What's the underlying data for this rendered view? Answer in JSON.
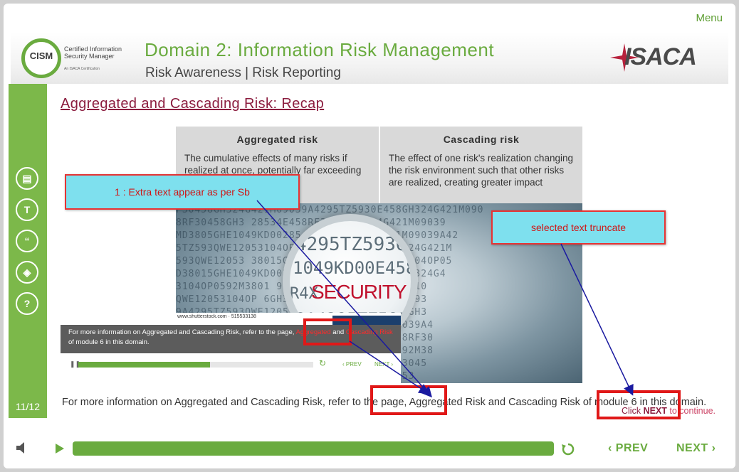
{
  "menu_label": "Menu",
  "header": {
    "cism_badge": "CISM",
    "cism_line1": "Certified Information",
    "cism_line2": "Security Manager",
    "cism_small": "An ISACA Certification",
    "title": "Domain 2: Information Risk Management",
    "subtitle": "Risk Awareness | Risk Reporting",
    "isaca_logo": "ISACA"
  },
  "sidebar": {
    "icons": [
      {
        "name": "notes-icon",
        "glyph": "▤"
      },
      {
        "name": "transcript-icon",
        "glyph": "T"
      },
      {
        "name": "quote-icon",
        "glyph": "“"
      },
      {
        "name": "layers-icon",
        "glyph": "◈"
      },
      {
        "name": "help-icon",
        "glyph": "?"
      }
    ],
    "slide_counter": "11/12"
  },
  "slide": {
    "title": "Aggregated and Cascading Risk: Recap",
    "aggregated": {
      "heading": "Aggregated risk",
      "text": "The cumulative effects of many risks if realized at once, potentially far exceeding the impact of any one risk"
    },
    "cascading": {
      "heading": "Cascading risk",
      "text": "The effect of one risk's realization changing the risk environment such that other risks are realized, creating greater impact"
    },
    "image_label": "SECURITY",
    "bottom_caption": "For more information on Aggregated and Cascading Risk, refer to the page, Aggregated Risk and Cascading Risk of module 6 in this domain.",
    "click_next_prefix": "Click ",
    "click_next_bold": "NEXT",
    "click_next_suffix": " to continue."
  },
  "inner_player": {
    "watermark": "www.shutterstock.com · 515533138",
    "caption_pre": "For more information on Aggregated and Cascading Risk, refer to the page, ",
    "caption_red1": "Aggregated",
    "caption_mid": " and ",
    "caption_red2": "Cascading Risk",
    "caption_post": " of module 6 in this domain.",
    "progress": 0.56,
    "prev_label": "‹ PREV",
    "next_label": "NEXT ›"
  },
  "controls": {
    "progress": 1.0,
    "prev_label": "‹ PREV",
    "next_label": "NEXT ›"
  },
  "annotations": {
    "callout1": "1 : Extra text appear as per Sb",
    "callout2": "selected text truncate"
  },
  "colors": {
    "brand_green": "#6aab3f",
    "title_maroon": "#8b1c3e",
    "callout_fill": "#7ee0ee",
    "annotation_red": "#e01818"
  }
}
